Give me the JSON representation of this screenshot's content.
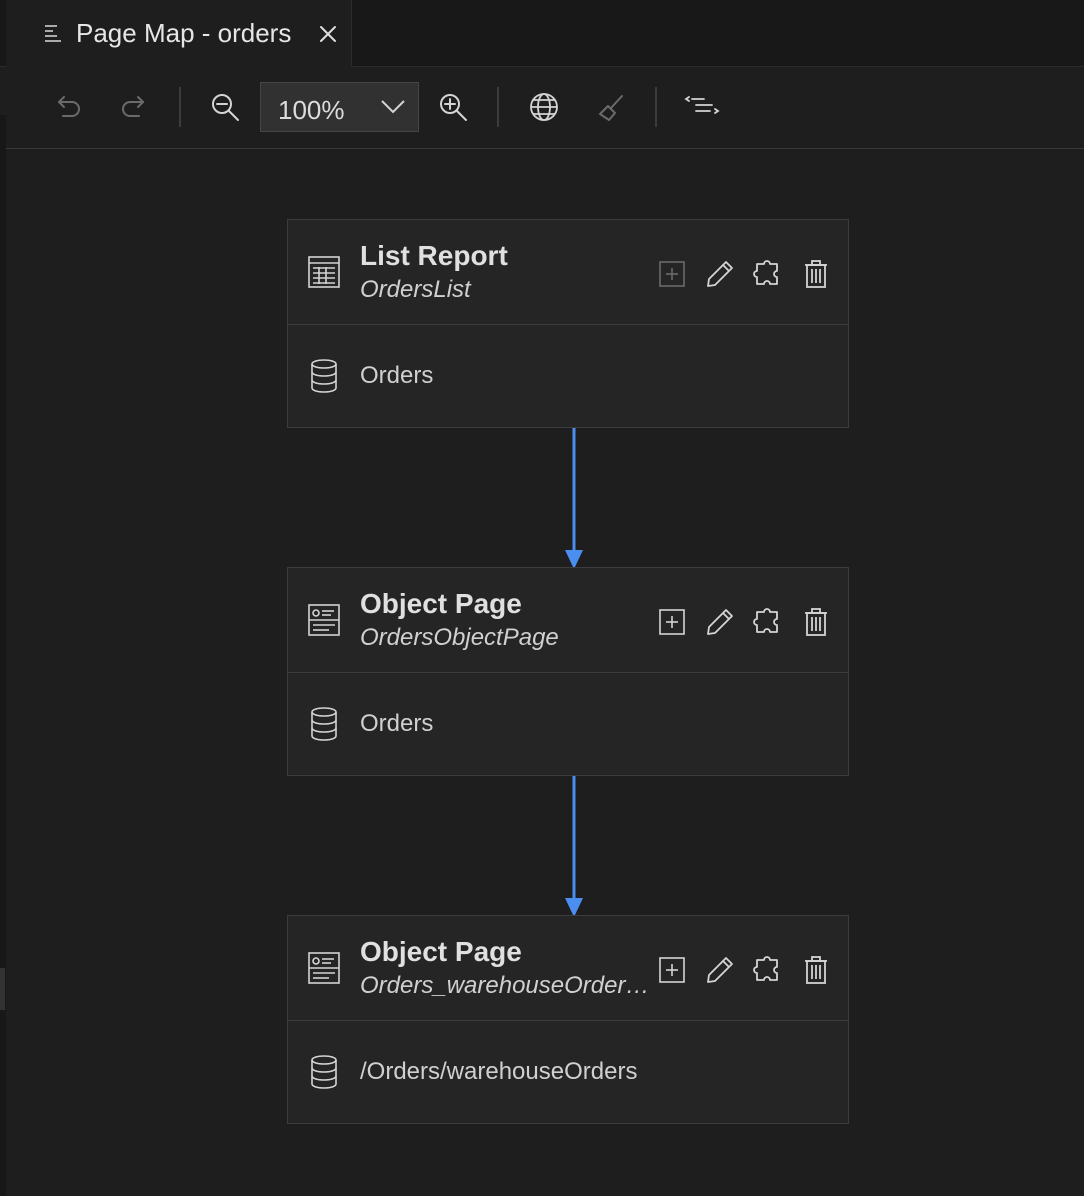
{
  "tab": {
    "title": "Page Map - orders",
    "icon": "page-map-icon"
  },
  "toolbar": {
    "zoom": "100%",
    "buttons": [
      "undo-icon",
      "redo-icon",
      "zoom-out-icon",
      "zoom-in-icon",
      "globe-icon",
      "broom-icon",
      "navigation-tree-icon"
    ]
  },
  "nodes": [
    {
      "type": "List Report",
      "name": "OrdersList",
      "entity": "Orders",
      "icon": "list-report-icon"
    },
    {
      "type": "Object Page",
      "name": "OrdersObjectPage",
      "entity": "Orders",
      "icon": "object-page-icon"
    },
    {
      "type": "Object Page",
      "name": "Orders_warehouseOrdersObjectPage",
      "entity": "/Orders/warehouseOrders",
      "icon": "object-page-icon"
    }
  ],
  "colors": {
    "arrow": "#4a8ef0",
    "background": "#1e1e1e",
    "node": "#252526"
  }
}
